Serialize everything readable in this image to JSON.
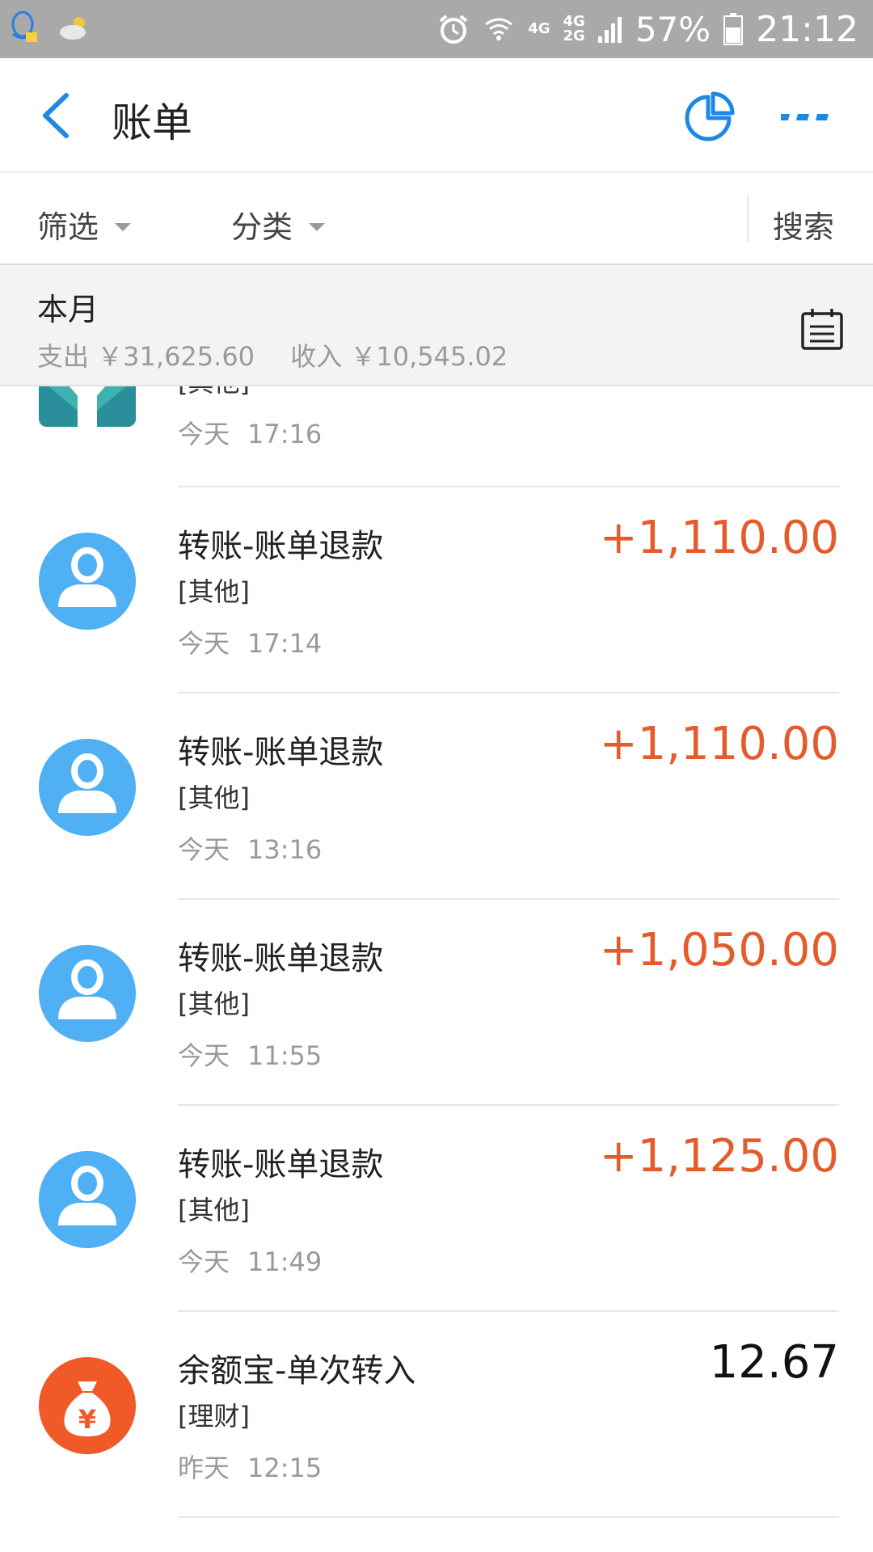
{
  "status_bar": {
    "network_1": "4G",
    "network_2_top": "4G",
    "network_2_bottom": "2G",
    "battery_percent": "57%",
    "time": "21:12"
  },
  "header": {
    "title": "账单"
  },
  "filters": {
    "filter_label": "筛选",
    "category_label": "分类",
    "search_label": "搜索"
  },
  "month": {
    "title": "本月",
    "expense": "支出 ￥31,625.60",
    "income": "收入 ￥10,545.02"
  },
  "colors": {
    "accent_blue": "#1e88e5",
    "income_orange": "#e55c2c",
    "avatar_blue": "#4fb0f4",
    "yuebao_orange": "#f05a28"
  },
  "transactions": [
    {
      "title": "",
      "category": "[其他]",
      "day": "今天",
      "time": "17:16",
      "amount": "",
      "icon": "merchant-logo-icon"
    },
    {
      "title": "转账-账单退款",
      "category": "[其他]",
      "day": "今天",
      "time": "17:14",
      "amount": "+1,110.00",
      "icon": "person-avatar-icon"
    },
    {
      "title": "转账-账单退款",
      "category": "[其他]",
      "day": "今天",
      "time": "13:16",
      "amount": "+1,110.00",
      "icon": "person-avatar-icon"
    },
    {
      "title": "转账-账单退款",
      "category": "[其他]",
      "day": "今天",
      "time": "11:55",
      "amount": "+1,050.00",
      "icon": "person-avatar-icon"
    },
    {
      "title": "转账-账单退款",
      "category": "[其他]",
      "day": "今天",
      "time": "11:49",
      "amount": "+1,125.00",
      "icon": "person-avatar-icon"
    },
    {
      "title": "余额宝-单次转入",
      "category": "[理财]",
      "day": "昨天",
      "time": "12:15",
      "amount": "12.67",
      "icon": "money-bag-icon"
    }
  ]
}
